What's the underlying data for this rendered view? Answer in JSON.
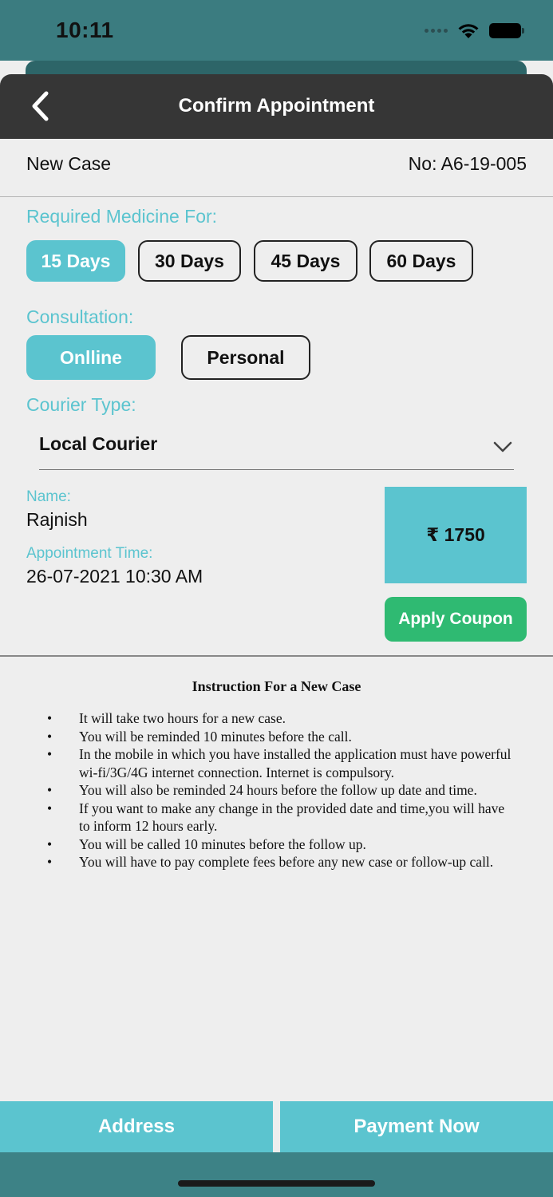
{
  "status_bar": {
    "time": "10:11"
  },
  "header": {
    "title": "Confirm Appointment"
  },
  "case": {
    "type": "New Case",
    "number": "No: A6-19-005"
  },
  "medicine": {
    "label": "Required Medicine For:",
    "options": [
      "15 Days",
      "30 Days",
      "45 Days",
      "60 Days"
    ],
    "selected": "15 Days"
  },
  "consultation": {
    "label": "Consultation:",
    "options": [
      "Onlline",
      "Personal"
    ],
    "selected": "Onlline"
  },
  "courier": {
    "label": "Courier Type:",
    "value": "Local Courier"
  },
  "patient": {
    "name_label": "Name:",
    "name": "Rajnish",
    "time_label": "Appointment Time:",
    "time": "26-07-2021 10:30 AM"
  },
  "price": "₹ 1750",
  "coupon_label": "Apply Coupon",
  "instructions": {
    "title": "Instruction For a New Case",
    "items": [
      "It will take two hours for a new case.",
      "You will be reminded 10 minutes before the call.",
      "In the mobile in which you have installed the application must have powerful wi-fi/3G/4G internet connection. Internet is compulsory.",
      "You will also be reminded 24 hours before the follow up date and time.",
      "If you want to make any change in the provided date and time,you will have to inform 12 hours early.",
      "You will be called 10 minutes before the follow up.",
      "You will have to pay complete fees before any new case or follow-up call."
    ]
  },
  "footer": {
    "address_label": "Address",
    "payment_label": "Payment Now"
  },
  "colors": {
    "accent": "#5bc4cf",
    "coupon": "#2fba72",
    "header": "#363636",
    "status_bar": "#3b7c80"
  }
}
